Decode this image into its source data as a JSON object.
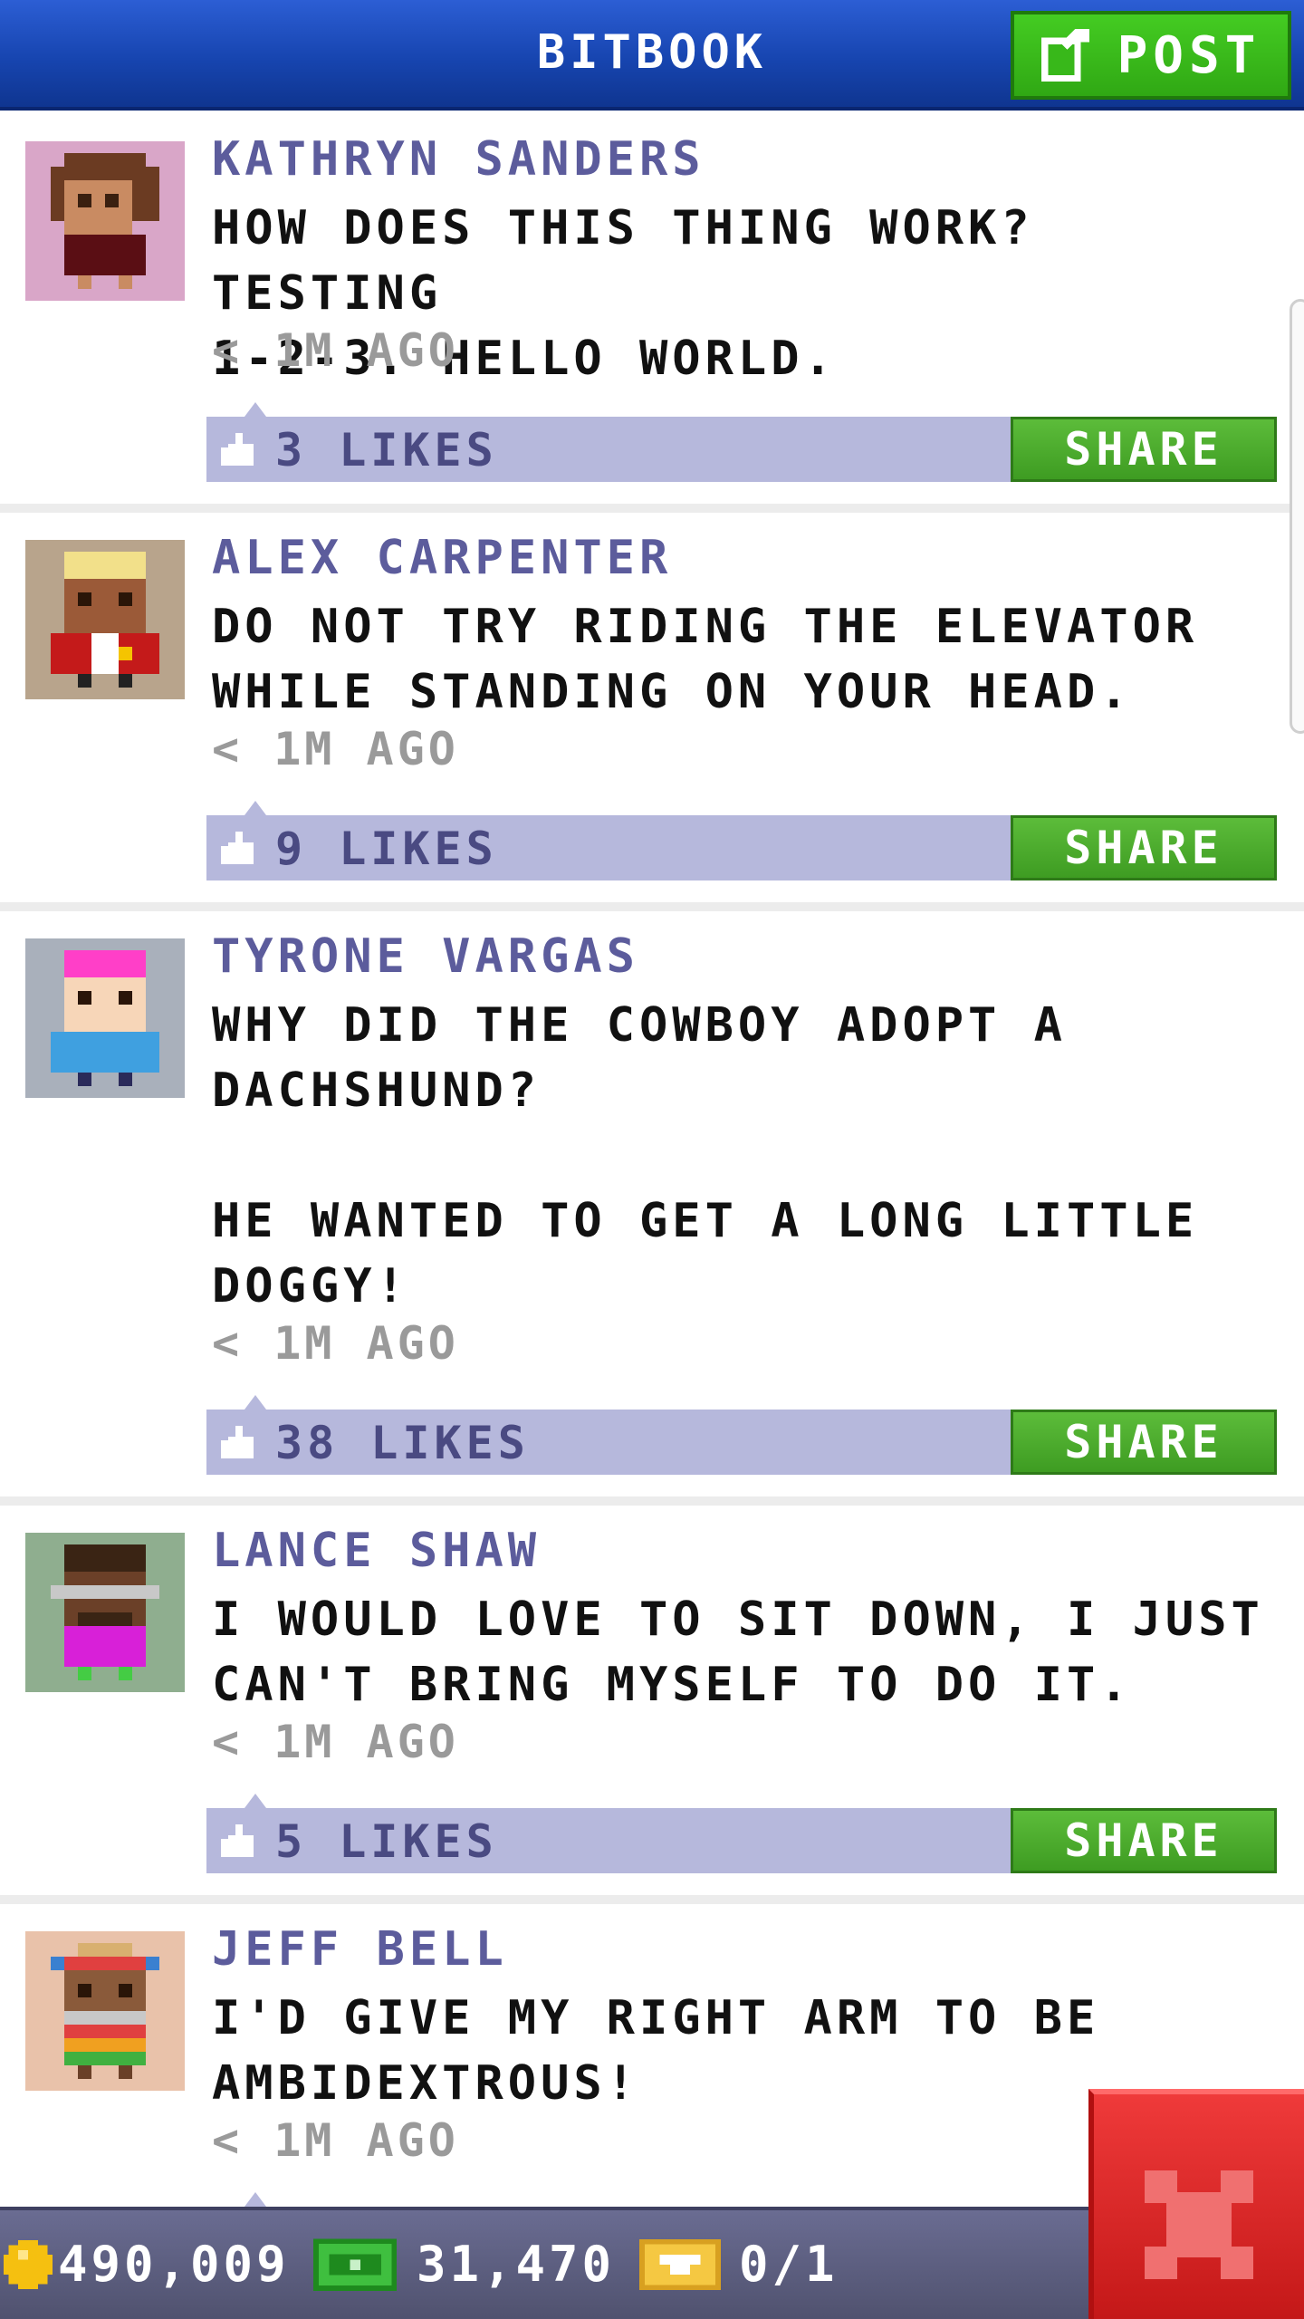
{
  "header": {
    "title": "BITBOOK",
    "post_label": "POST"
  },
  "posts": [
    {
      "author": "KATHRYN SANDERS",
      "message": "HOW DOES THIS THING WORK? TESTING\n1-2-3. HELLO WORLD.",
      "time": "< 1M AGO",
      "likes": "3 LIKES",
      "share_label": "SHARE",
      "avatar_bg": "#d9a6c8"
    },
    {
      "author": "ALEX CARPENTER",
      "message": "DO NOT TRY RIDING THE ELEVATOR\nWHILE STANDING ON YOUR HEAD.",
      "time": "< 1M AGO",
      "likes": "9 LIKES",
      "share_label": "SHARE",
      "avatar_bg": "#b8a48c"
    },
    {
      "author": "TYRONE VARGAS",
      "message": "WHY DID THE COWBOY ADOPT A\nDACHSHUND?\n\nHE WANTED TO GET A LONG LITTLE\nDOGGY!",
      "time": "< 1M AGO",
      "likes": "38 LIKES",
      "share_label": "SHARE",
      "avatar_bg": "#a9b0bb"
    },
    {
      "author": "LANCE SHAW",
      "message": "I WOULD LOVE TO SIT DOWN, I JUST\nCAN'T BRING MYSELF TO DO IT.",
      "time": "< 1M AGO",
      "likes": "5 LIKES",
      "share_label": "SHARE",
      "avatar_bg": "#8fae8f"
    },
    {
      "author": "JEFF BELL",
      "message": "I'D GIVE MY RIGHT ARM TO BE\nAMBIDEXTROUS!",
      "time": "< 1M AGO",
      "avatar_bg": "#e9c2aa"
    }
  ],
  "bottom_bar": {
    "coins": "490,009",
    "bux": "31,470",
    "tickets": "0/1"
  },
  "icons": {
    "post": "edit-icon",
    "like": "thumbs-up-icon",
    "coins": "coin-icon",
    "bux": "bux-icon",
    "tickets": "vip-ticket-icon",
    "close": "close-icon"
  },
  "colors": {
    "header_blue": "#1745b0",
    "post_green": "#30a814",
    "share_green": "#3e9c22",
    "like_bar": "#b6b8dc",
    "author_text": "#5c5c9c",
    "close_red": "#d42020"
  }
}
